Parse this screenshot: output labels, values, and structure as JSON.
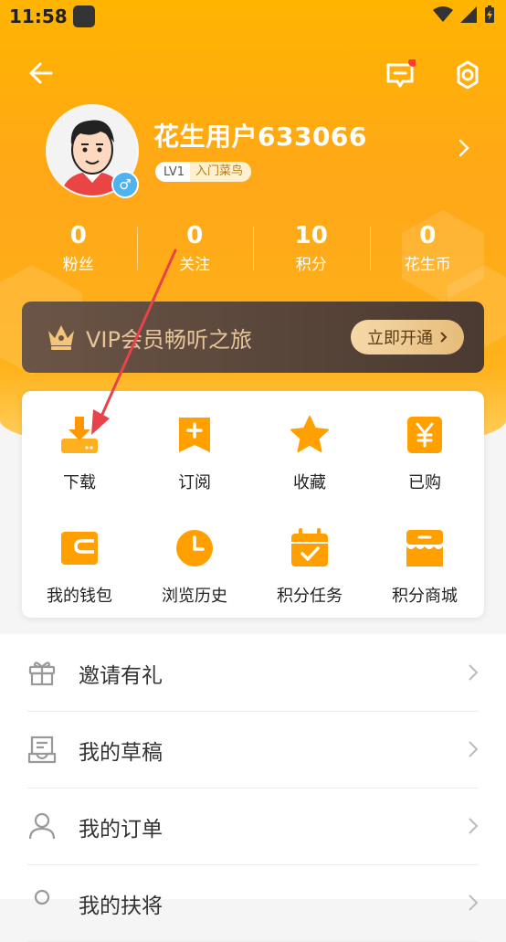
{
  "status_bar": {
    "time": "11:58"
  },
  "profile": {
    "username": "花生用户633066",
    "level": "LV1",
    "level_name": "入门菜鸟",
    "gender_symbol": "♂"
  },
  "stats": [
    {
      "value": "0",
      "label": "粉丝"
    },
    {
      "value": "0",
      "label": "关注"
    },
    {
      "value": "10",
      "label": "积分"
    },
    {
      "value": "0",
      "label": "花生币"
    }
  ],
  "vip": {
    "text": "VIP会员畅听之旅",
    "button": "立即开通"
  },
  "grid": [
    {
      "label": "下载",
      "icon": "download-icon"
    },
    {
      "label": "订阅",
      "icon": "subscribe-icon"
    },
    {
      "label": "收藏",
      "icon": "star-icon"
    },
    {
      "label": "已购",
      "icon": "yen-icon"
    },
    {
      "label": "我的钱包",
      "icon": "wallet-icon"
    },
    {
      "label": "浏览历史",
      "icon": "clock-icon"
    },
    {
      "label": "积分任务",
      "icon": "calendar-check-icon"
    },
    {
      "label": "积分商城",
      "icon": "store-icon"
    }
  ],
  "list": [
    {
      "label": "邀请有礼",
      "icon": "gift-icon"
    },
    {
      "label": "我的草稿",
      "icon": "draft-icon"
    },
    {
      "label": "我的订单",
      "icon": "user-icon"
    },
    {
      "label": "我的扶将",
      "icon": "user-icon"
    }
  ],
  "colors": {
    "primary": "#ffa718",
    "vip_gold": "#e8c49a",
    "icon_orange": "#ffaa00"
  }
}
